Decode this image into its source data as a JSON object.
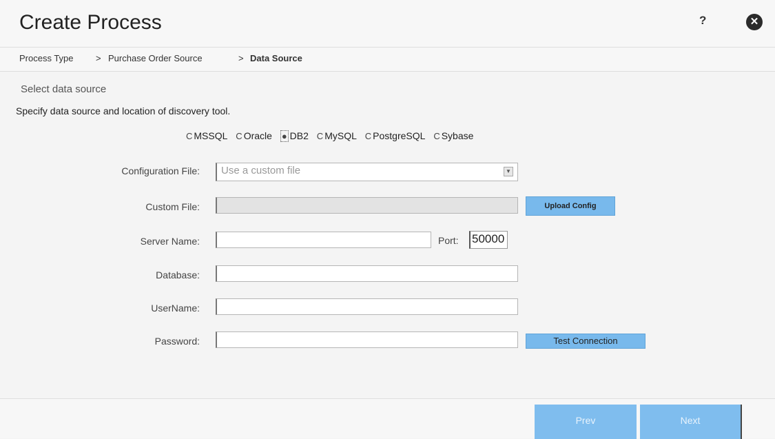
{
  "header": {
    "title": "Create Process",
    "help_label": "?",
    "close_glyph": "✕"
  },
  "breadcrumb": {
    "items": [
      "Process Type",
      "Purchase Order Source",
      "Data Source"
    ],
    "separator": ">"
  },
  "section": {
    "title": "Select data source",
    "instruction": "Specify data source and location of discovery tool."
  },
  "data_source": {
    "options": [
      "MSSQL",
      "Oracle",
      "DB2",
      "MySQL",
      "PostgreSQL",
      "Sybase"
    ],
    "selected": "DB2"
  },
  "form": {
    "config_file_label": "Configuration File:",
    "config_file_value": "Use a custom file",
    "custom_file_label": "Custom File:",
    "custom_file_value": "",
    "upload_button": "Upload Config",
    "server_name_label": "Server Name:",
    "server_name_value": "",
    "port_label": "Port:",
    "port_value": "50000",
    "database_label": "Database:",
    "database_value": "",
    "username_label": "UserName:",
    "username_value": "",
    "password_label": "Password:",
    "password_value": "",
    "test_button": "Test Connection"
  },
  "footer": {
    "prev_label": "Prev",
    "next_label": "Next"
  },
  "colors": {
    "accent_button": "#78b9ec",
    "nav_button": "#7fbdee",
    "background": "#f4f4f4"
  }
}
